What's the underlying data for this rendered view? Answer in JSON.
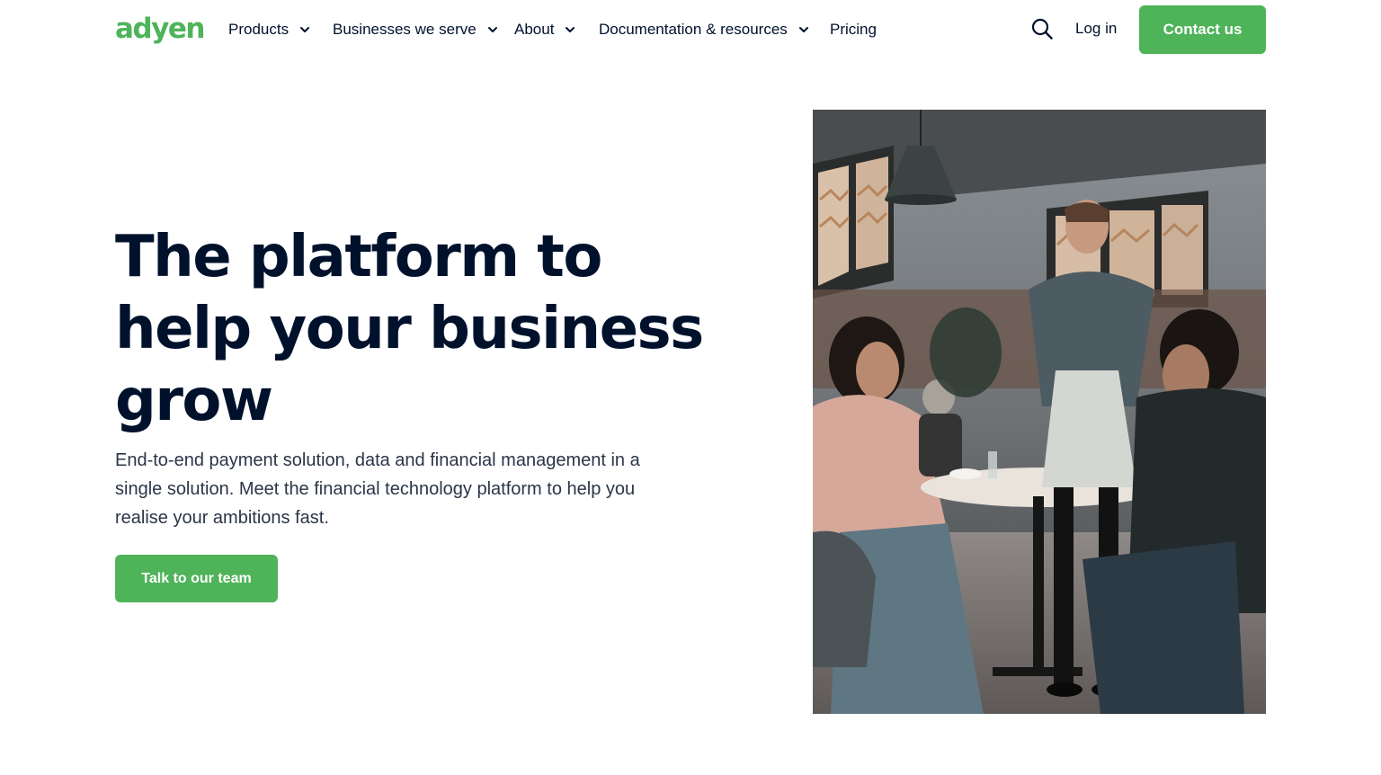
{
  "header": {
    "logo_text": "adyen",
    "nav": [
      {
        "label": "Products",
        "icon": "chevron-down-icon"
      },
      {
        "label": "Businesses we serve",
        "icon": "chevron-down-icon"
      },
      {
        "label": "About",
        "icon": "chevron-down-icon"
      },
      {
        "label": "Documentation & resources",
        "icon": "chevron-down-icon"
      },
      {
        "label": "Pricing"
      }
    ],
    "search_icon": "search-icon",
    "login_label": "Log in",
    "contact_label": "Contact us"
  },
  "hero": {
    "title_lines": [
      "The platform to",
      "help your business",
      "grow"
    ],
    "subtitle": "End-to-end payment solution, data and financial management in a single solution. Meet the financial technology platform to help you realise your ambitions fast.",
    "cta_label": "Talk to our team",
    "image_icon": "restaurant-photo"
  },
  "colors": {
    "brand_green": "#4fb35a",
    "text_dark": "#00112c",
    "text_body": "#2b3548",
    "background": "#ffffff"
  }
}
